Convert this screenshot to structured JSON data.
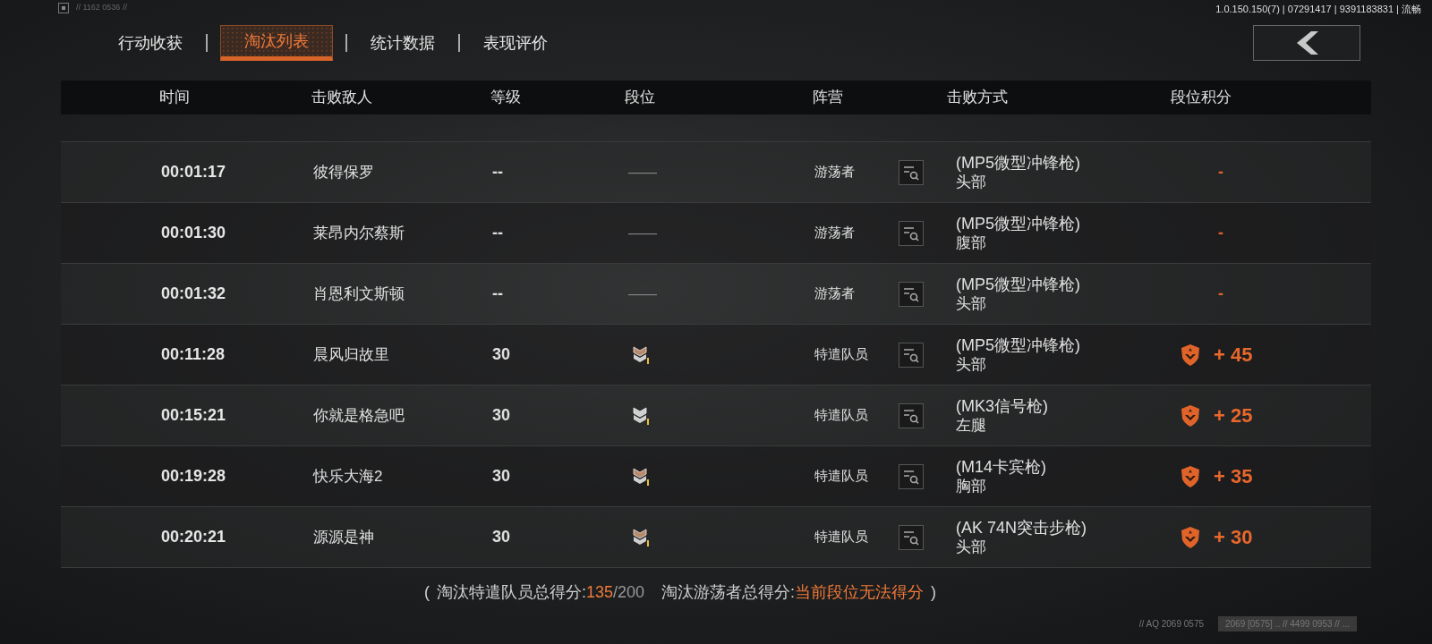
{
  "build_info": "1.0.150.150(7) | 07291417 | 9391183831 | 流畅",
  "corner_code": "// 1162  0536 //",
  "tabs": [
    {
      "label": "行动收获",
      "selected": false
    },
    {
      "label": "淘汰列表",
      "selected": true
    },
    {
      "label": "统计数据",
      "selected": false
    },
    {
      "label": "表现评价",
      "selected": false
    }
  ],
  "table": {
    "columns": [
      "时间",
      "击败敌人",
      "等级",
      "段位",
      "阵营",
      "击败方式",
      "段位积分"
    ],
    "rows": [
      {
        "time": "00:01:17",
        "enemy": "彼得保罗",
        "level": "--",
        "rank": {
          "kind": "none",
          "text": "——"
        },
        "camp": "游荡者",
        "weapon": "(MP5微型冲锋枪)",
        "hit": "头部",
        "score": {
          "kind": "none",
          "text": "-"
        }
      },
      {
        "time": "00:01:30",
        "enemy": "莱昂内尔蔡斯",
        "level": "--",
        "rank": {
          "kind": "none",
          "text": "——"
        },
        "camp": "游荡者",
        "weapon": "(MP5微型冲锋枪)",
        "hit": "腹部",
        "score": {
          "kind": "none",
          "text": "-"
        }
      },
      {
        "time": "00:01:32",
        "enemy": "肖恩利文斯顿",
        "level": "--",
        "rank": {
          "kind": "none",
          "text": "——"
        },
        "camp": "游荡者",
        "weapon": "(MP5微型冲锋枪)",
        "hit": "头部",
        "score": {
          "kind": "none",
          "text": "-"
        }
      },
      {
        "time": "00:11:28",
        "enemy": "晨风归故里",
        "level": "30",
        "rank": {
          "kind": "bronze"
        },
        "camp": "特遣队员",
        "weapon": "(MP5微型冲锋枪)",
        "hit": "头部",
        "score": {
          "kind": "badge",
          "text": "+ 45"
        }
      },
      {
        "time": "00:15:21",
        "enemy": "你就是格急吧",
        "level": "30",
        "rank": {
          "kind": "silver"
        },
        "camp": "特遣队员",
        "weapon": "(MK3信号枪)",
        "hit": "左腿",
        "score": {
          "kind": "badge",
          "text": "+ 25"
        }
      },
      {
        "time": "00:19:28",
        "enemy": "快乐大海2",
        "level": "30",
        "rank": {
          "kind": "bronze"
        },
        "camp": "特遣队员",
        "weapon": "(M14卡宾枪)",
        "hit": "胸部",
        "score": {
          "kind": "badge",
          "text": "+ 35"
        }
      },
      {
        "time": "00:20:21",
        "enemy": "源源是神",
        "level": "30",
        "rank": {
          "kind": "bronze"
        },
        "camp": "特遣队员",
        "weapon": "(AK 74N突击步枪)",
        "hit": "头部",
        "score": {
          "kind": "badge",
          "text": "+ 30"
        }
      }
    ]
  },
  "summary": {
    "open": "(",
    "agent_label": "淘汰特遣队员总得分:",
    "agent_score": "135",
    "agent_max": "/200",
    "wanderer_label": "淘汰游荡者总得分:",
    "wanderer_value": "当前段位无法得分",
    "close": ")"
  },
  "footer_codes": [
    "// AQ 2069 0575",
    "2069  [0575]  ..  // 4499 0953 //  ..."
  ]
}
